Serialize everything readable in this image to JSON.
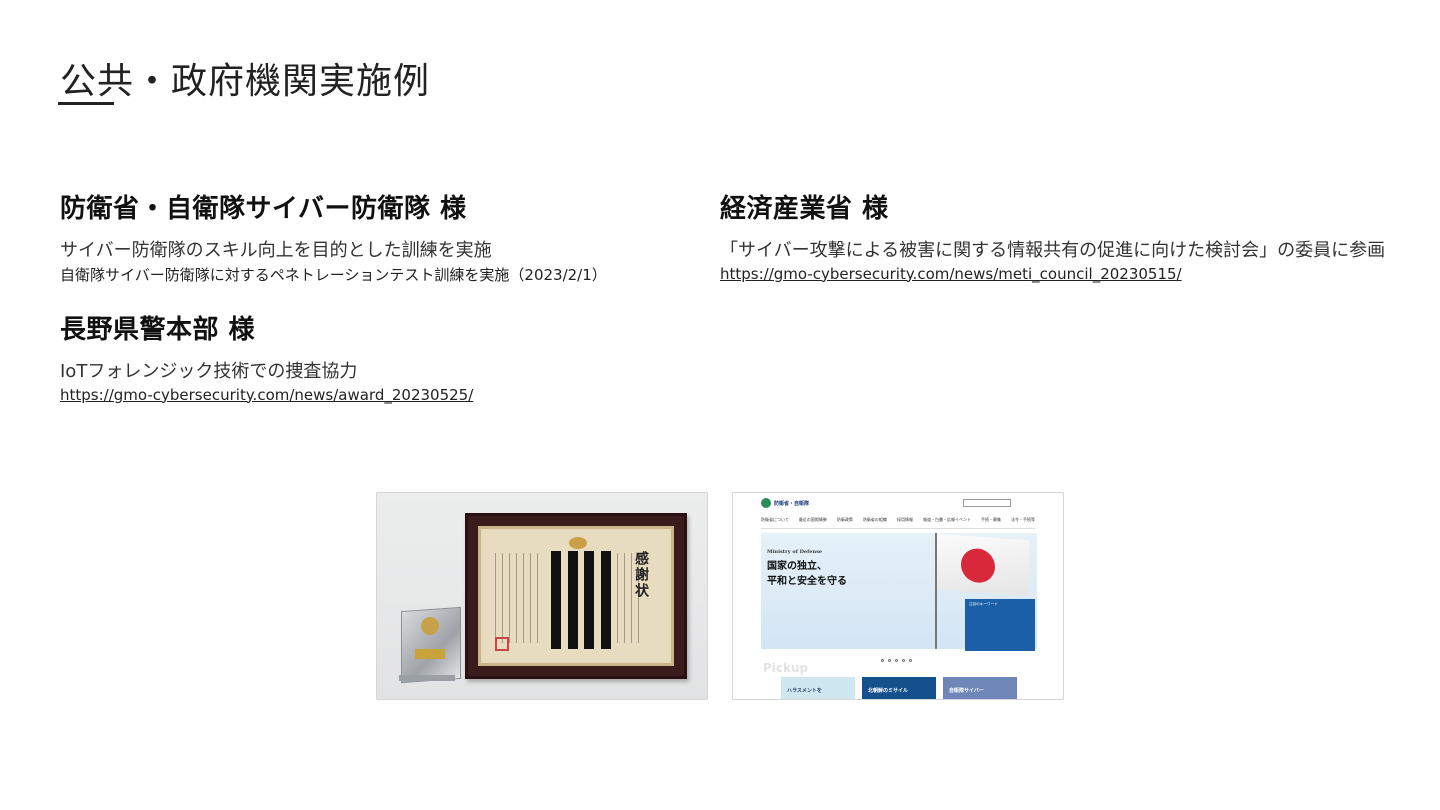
{
  "page": {
    "title": "公共・政府機関実施例"
  },
  "cases": {
    "mod": {
      "heading": "防衛省・自衛隊サイバー防衛隊 様",
      "description": "サイバー防衛隊のスキル向上を目的とした訓練を実施",
      "note": "自衛隊サイバー防衛隊に対するペネトレーションテスト訓練を実施（2023/2/1）"
    },
    "meti": {
      "heading": "経済産業省 様",
      "description": "「サイバー攻撃による被害に関する情報共有の促進に向けた検討会」の委員に参画",
      "link": "https://gmo-cybersecurity.com/news/meti_council_20230515/"
    },
    "nagano": {
      "heading": "長野県警本部 様",
      "description": "IoTフォレンジック技術での捜査協力",
      "link": "https://gmo-cybersecurity.com/news/award_20230525/"
    }
  },
  "images": {
    "certificate": {
      "cert_title": "感謝状"
    },
    "website": {
      "logo_text": "防衛省・自衛隊",
      "nav": [
        "防衛省について",
        "最近の国際情勢",
        "防衛政策",
        "防衛省の組織",
        "採用情報",
        "報道・白書・広報イベント",
        "手続・募集",
        "法令・手続等"
      ],
      "ministry_label": "Ministry of Defense",
      "hero_line1": "国家の独立、",
      "hero_line2": "平和と安全を守る",
      "panel_title": "注目のキーワード",
      "pickup_label": "Pickup",
      "tile1": "ハラスメントを",
      "tile2": "北朝鮮のミサイル",
      "tile3": "自衛隊サイバー"
    }
  }
}
